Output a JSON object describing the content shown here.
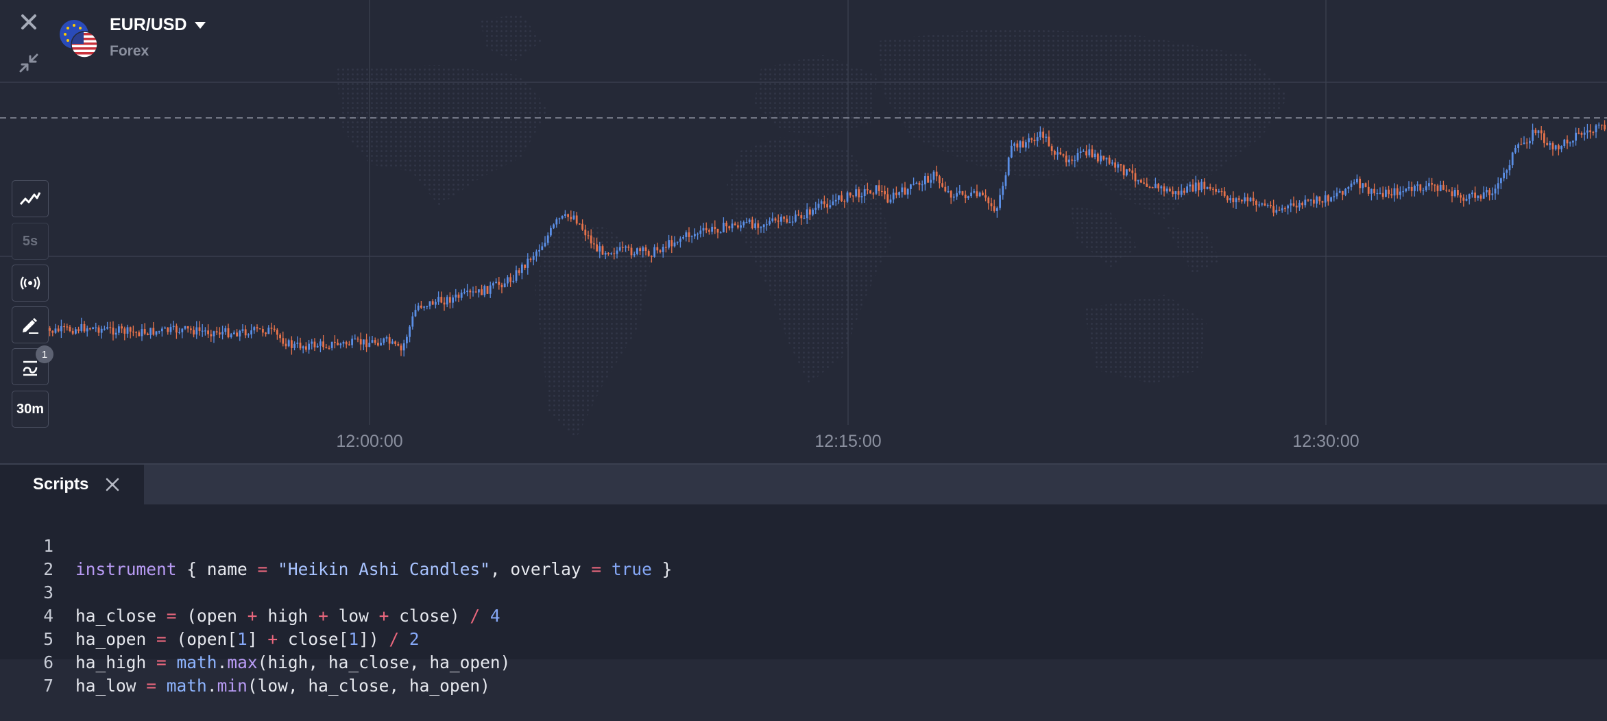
{
  "colors": {
    "background": "#252937",
    "up_candle": "#5b8fe6",
    "down_candle": "#e8734b",
    "grid": "#3d4252",
    "axis_text": "#8a8f9e"
  },
  "header": {
    "asset_name": "EUR/USD",
    "asset_type": "Forex",
    "close_icon": "close-icon",
    "minimize_icon": "collapse-icon"
  },
  "toolbar": {
    "chart_type_icon": "chart-type-icon",
    "interval_label": "5s",
    "live_icon": "broadcast-icon",
    "draw_icon": "pencil-icon",
    "indicators_icon": "indicators-icon",
    "indicators_count": "1",
    "timeframe_label": "30m"
  },
  "chart_data": {
    "type": "candlestick",
    "title": "",
    "x_tick_labels": [
      "12:00:00",
      "12:15:00",
      "12:30:00"
    ],
    "shape": [
      [
        0,
        0.86
      ],
      [
        0.03,
        0.84
      ],
      [
        0.06,
        0.86
      ],
      [
        0.09,
        0.85
      ],
      [
        0.12,
        0.86
      ],
      [
        0.145,
        0.85
      ],
      [
        0.16,
        0.91
      ],
      [
        0.2,
        0.9
      ],
      [
        0.22,
        0.89
      ],
      [
        0.23,
        0.93
      ],
      [
        0.24,
        0.76
      ],
      [
        0.28,
        0.71
      ],
      [
        0.3,
        0.66
      ],
      [
        0.32,
        0.53
      ],
      [
        0.33,
        0.44
      ],
      [
        0.34,
        0.42
      ],
      [
        0.355,
        0.55
      ],
      [
        0.39,
        0.56
      ],
      [
        0.41,
        0.5
      ],
      [
        0.44,
        0.46
      ],
      [
        0.48,
        0.44
      ],
      [
        0.5,
        0.38
      ],
      [
        0.52,
        0.34
      ],
      [
        0.535,
        0.32
      ],
      [
        0.54,
        0.36
      ],
      [
        0.555,
        0.32
      ],
      [
        0.57,
        0.27
      ],
      [
        0.58,
        0.34
      ],
      [
        0.6,
        0.35
      ],
      [
        0.61,
        0.4
      ],
      [
        0.62,
        0.17
      ],
      [
        0.64,
        0.12
      ],
      [
        0.65,
        0.21
      ],
      [
        0.67,
        0.19
      ],
      [
        0.69,
        0.25
      ],
      [
        0.71,
        0.31
      ],
      [
        0.725,
        0.34
      ],
      [
        0.74,
        0.31
      ],
      [
        0.76,
        0.36
      ],
      [
        0.775,
        0.37
      ],
      [
        0.79,
        0.4
      ],
      [
        0.82,
        0.36
      ],
      [
        0.84,
        0.3
      ],
      [
        0.85,
        0.34
      ],
      [
        0.87,
        0.33
      ],
      [
        0.89,
        0.31
      ],
      [
        0.91,
        0.36
      ],
      [
        0.93,
        0.32
      ],
      [
        0.94,
        0.19
      ],
      [
        0.955,
        0.1
      ],
      [
        0.965,
        0.18
      ],
      [
        0.98,
        0.12
      ],
      [
        1,
        0.09
      ]
    ],
    "current_price_line": "dashed"
  },
  "panel": {
    "tab_label": "Scripts",
    "tab_close_icon": "close-icon",
    "line_numbers": [
      "1",
      "2",
      "3",
      "4",
      "5",
      "6",
      "7"
    ],
    "code": {
      "l1": {
        "kw": "instrument",
        "t1": " { name ",
        "eq1": "=",
        "t2": " ",
        "str": "\"Heikin Ashi Candles\"",
        "t3": ", overlay ",
        "eq2": "=",
        "t4": " ",
        "val": "true",
        "t5": " }"
      },
      "l3": {
        "a": "ha_close ",
        "eq": "=",
        "b": " (open ",
        "p1": "+",
        "c": " high ",
        "p2": "+",
        "d": " low ",
        "p3": "+",
        "e": " close) ",
        "div": "/",
        "f": " ",
        "n": "4"
      },
      "l4": {
        "a": "ha_open ",
        "eq": "=",
        "b": " (open[",
        "n1": "1",
        "c": "] ",
        "p": "+",
        "d": " close[",
        "n2": "1",
        "e": "]) ",
        "div": "/",
        "f": " ",
        "n3": "2"
      },
      "l5": {
        "a": "ha_high ",
        "eq": "=",
        "b": " ",
        "ns": "math",
        "dot": ".",
        "fn": "max",
        "args": "(high, ha_close, ha_open)"
      },
      "l6": {
        "a": "ha_low ",
        "eq": "=",
        "b": " ",
        "ns": "math",
        "dot": ".",
        "fn": "min",
        "args": "(low, ha_close, ha_open)"
      }
    }
  }
}
